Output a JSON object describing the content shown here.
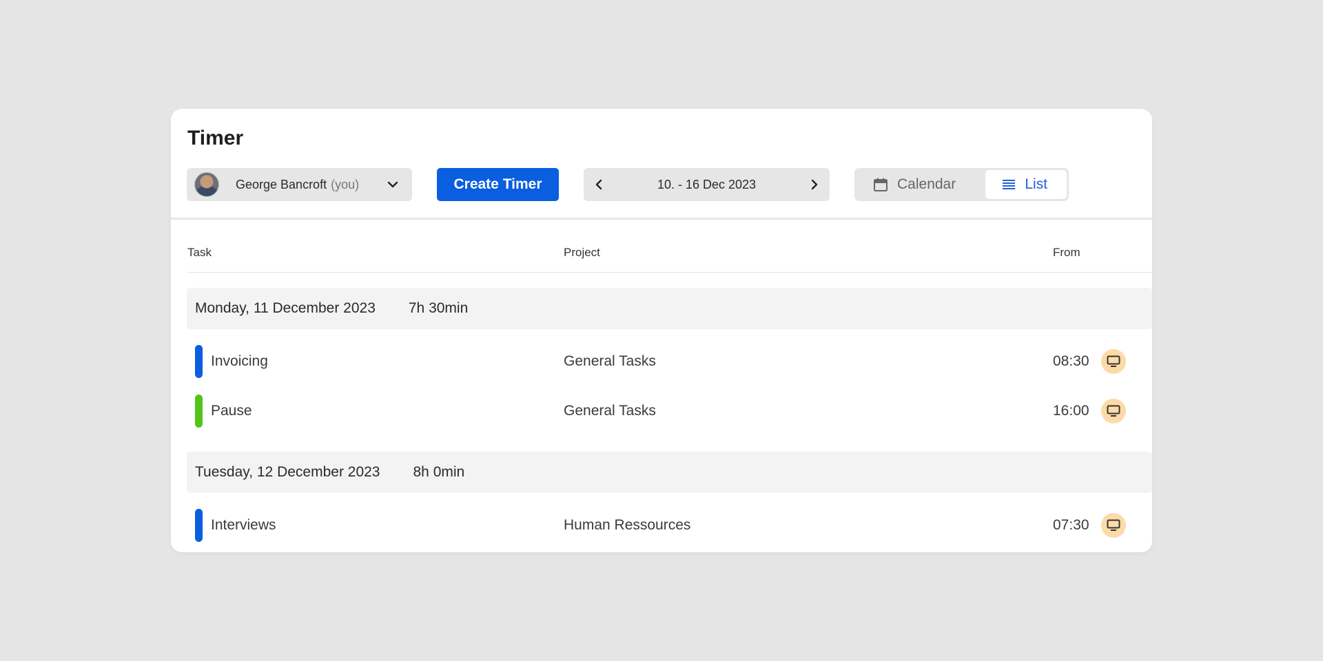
{
  "header": {
    "title": "Timer"
  },
  "user_select": {
    "name": "George Bancroft",
    "suffix": "(you)"
  },
  "toolbar": {
    "create_label": "Create Timer",
    "date_range": "10. - 16 Dec 2023"
  },
  "view_toggle": {
    "calendar_label": "Calendar",
    "list_label": "List",
    "selected": "List"
  },
  "table": {
    "columns": [
      "Task",
      "Project",
      "From"
    ]
  },
  "days": [
    {
      "date": "Monday, 11 December 2023",
      "total": "7h 30min",
      "entries": [
        {
          "task": "Invoicing",
          "project": "General Tasks",
          "from": "08:30",
          "color": "#0a5ee0",
          "icon": "monitor-icon"
        },
        {
          "task": "Pause",
          "project": "General Tasks",
          "from": "16:00",
          "color": "#52c41a",
          "icon": "monitor-icon"
        }
      ]
    },
    {
      "date": "Tuesday, 12 December 2023",
      "total": "8h 0min",
      "entries": [
        {
          "task": "Interviews",
          "project": "Human Ressources",
          "from": "07:30",
          "color": "#0a5ee0",
          "icon": "monitor-icon"
        }
      ]
    }
  ],
  "colors": {
    "accent": "#0a5ee0",
    "pause": "#52c41a",
    "device_badge": "#fcdba8"
  }
}
